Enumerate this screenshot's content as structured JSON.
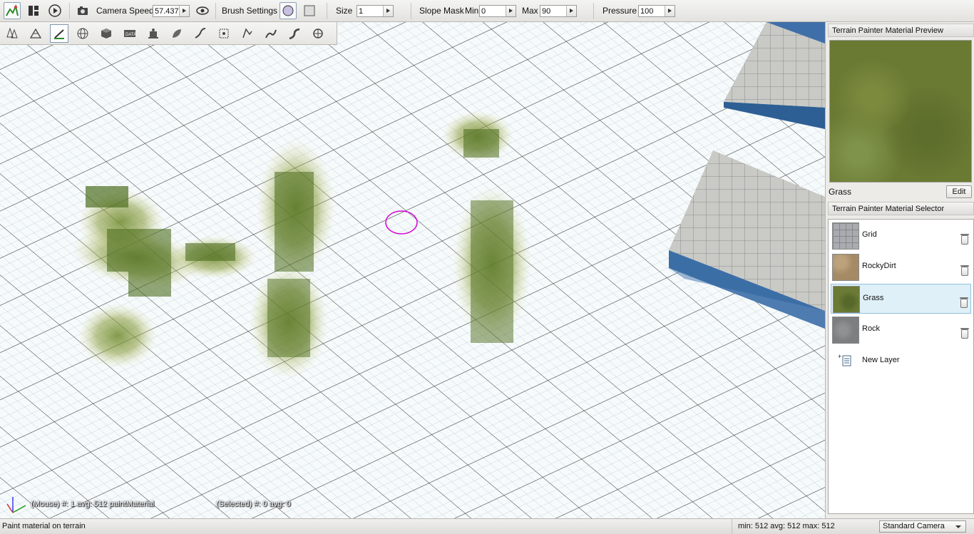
{
  "toolbar": {
    "camera_speed_label": "Camera Speed",
    "camera_speed_value": "57.437",
    "brush_settings_label": "Brush Settings",
    "size_label": "Size",
    "size_value": "1",
    "slope_mask_label": "Slope Mask",
    "min_label": "Min",
    "min_value": "0",
    "max_label": "Max",
    "max_value": "90",
    "pressure_label": "Pressure",
    "pressure_value": "100"
  },
  "tools": [
    "forest-tool-icon",
    "terrain-tool-icon",
    "paint-brush-icon",
    "globe-icon",
    "cube-icon",
    "data-icon",
    "robot-icon",
    "leaf-icon",
    "river-icon",
    "select-box-icon",
    "road-icon",
    "mesh-road-icon",
    "decal-road-icon",
    "camera-path-icon"
  ],
  "viewport": {
    "mouse_info": "(Mouse) #: 1  avg: 512 paintMaterial",
    "selected_info": "(Selected) #: 0  avg: 0"
  },
  "preview_panel": {
    "title": "Terrain Painter Material Preview",
    "material_name": "Grass",
    "edit_label": "Edit"
  },
  "selector_panel": {
    "title": "Terrain Painter Material Selector",
    "materials": [
      {
        "name": "Grid",
        "color": "#a9abb0"
      },
      {
        "name": "RockyDirt",
        "color": "#a58a66"
      },
      {
        "name": "Grass",
        "color": "#6b7a34"
      },
      {
        "name": "Rock",
        "color": "#7d7e80"
      }
    ],
    "selected_material": "Grass",
    "new_layer_label": "New Layer"
  },
  "statusbar": {
    "message": "Paint material on terrain",
    "stats": "min: 512  avg: 512  max: 512",
    "camera_mode": "Standard Camera"
  },
  "colors": {
    "accent_selection": "#dff0f8",
    "brush_ring": "#d400d4",
    "grass": "#5f7a2a"
  }
}
